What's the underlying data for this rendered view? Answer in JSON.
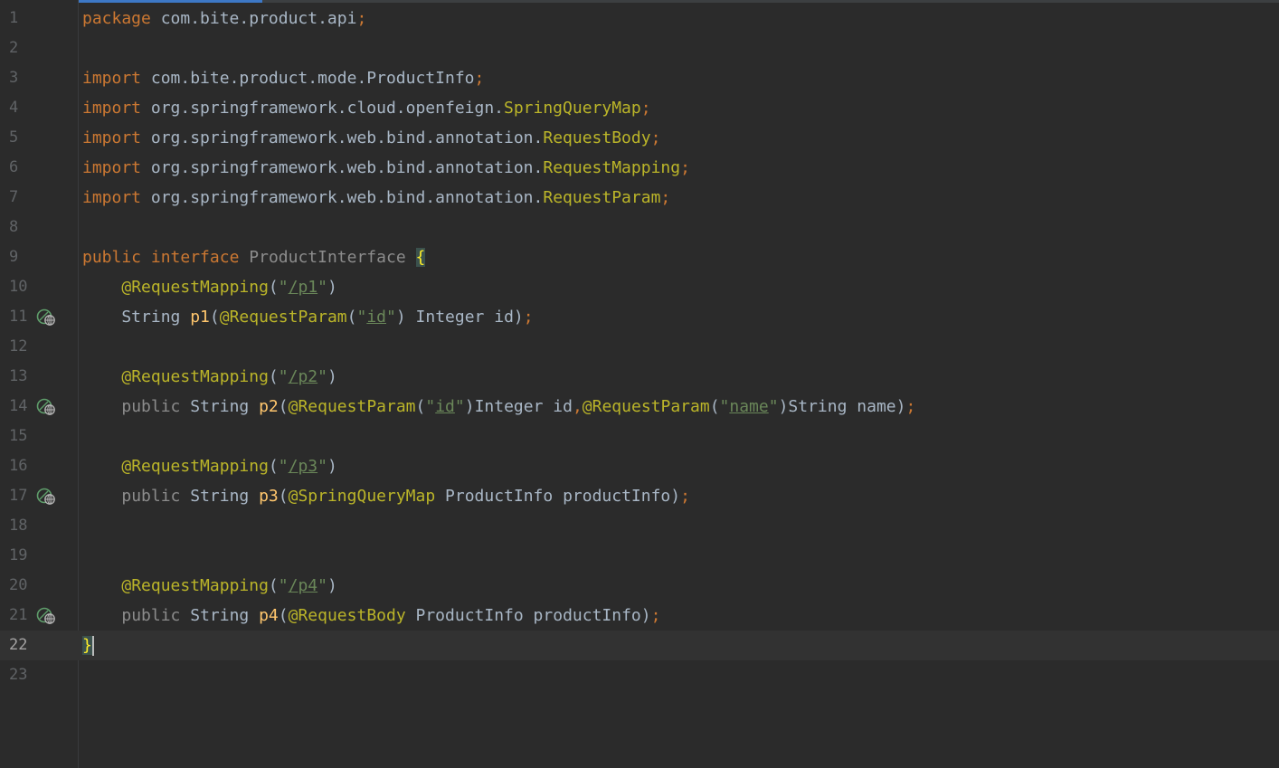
{
  "editor": {
    "progress_fraction": 0.205,
    "current_line": 22,
    "lines": [
      {
        "n": "1",
        "tokens": [
          {
            "t": "package",
            "c": "kw"
          },
          {
            "t": " com.bite.product.api",
            "c": "plain"
          },
          {
            "t": ";",
            "c": "kw"
          }
        ]
      },
      {
        "n": "2",
        "tokens": []
      },
      {
        "n": "3",
        "tokens": [
          {
            "t": "import",
            "c": "kw"
          },
          {
            "t": " com.bite.product.mode.ProductInfo",
            "c": "plain"
          },
          {
            "t": ";",
            "c": "kw"
          }
        ]
      },
      {
        "n": "4",
        "tokens": [
          {
            "t": "import",
            "c": "kw"
          },
          {
            "t": " org.springframework.cloud.openfeign.",
            "c": "plain"
          },
          {
            "t": "SpringQueryMap",
            "c": "ann"
          },
          {
            "t": ";",
            "c": "kw"
          }
        ]
      },
      {
        "n": "5",
        "tokens": [
          {
            "t": "import",
            "c": "kw"
          },
          {
            "t": " org.springframework.web.bind.annotation.",
            "c": "plain"
          },
          {
            "t": "RequestBody",
            "c": "ann"
          },
          {
            "t": ";",
            "c": "kw"
          }
        ]
      },
      {
        "n": "6",
        "tokens": [
          {
            "t": "import",
            "c": "kw"
          },
          {
            "t": " org.springframework.web.bind.annotation.",
            "c": "plain"
          },
          {
            "t": "RequestMapping",
            "c": "ann"
          },
          {
            "t": ";",
            "c": "kw"
          }
        ]
      },
      {
        "n": "7",
        "tokens": [
          {
            "t": "import",
            "c": "kw"
          },
          {
            "t": " org.springframework.web.bind.annotation.",
            "c": "plain"
          },
          {
            "t": "RequestParam",
            "c": "ann"
          },
          {
            "t": ";",
            "c": "kw"
          }
        ]
      },
      {
        "n": "8",
        "tokens": []
      },
      {
        "n": "9",
        "tokens": [
          {
            "t": "public",
            "c": "kw"
          },
          {
            "t": " ",
            "c": "plain"
          },
          {
            "t": "interface",
            "c": "kw"
          },
          {
            "t": " ",
            "c": "plain"
          },
          {
            "t": "ProductInterface",
            "c": "cls-unused"
          },
          {
            "t": " ",
            "c": "plain"
          },
          {
            "t": "{",
            "c": "brace-hl"
          }
        ]
      },
      {
        "n": "10",
        "tokens": [
          {
            "t": "    ",
            "c": "plain"
          },
          {
            "t": "@RequestMapping",
            "c": "ann"
          },
          {
            "t": "(",
            "c": "plain"
          },
          {
            "t": "\"",
            "c": "str"
          },
          {
            "t": "/p1",
            "c": "strlink"
          },
          {
            "t": "\"",
            "c": "str"
          },
          {
            "t": ")",
            "c": "plain"
          }
        ]
      },
      {
        "n": "11",
        "icon": true,
        "tokens": [
          {
            "t": "    String ",
            "c": "plain"
          },
          {
            "t": "p1",
            "c": "fn"
          },
          {
            "t": "(",
            "c": "plain"
          },
          {
            "t": "@RequestParam",
            "c": "ann"
          },
          {
            "t": "(",
            "c": "plain"
          },
          {
            "t": "\"",
            "c": "str"
          },
          {
            "t": "id",
            "c": "strlink"
          },
          {
            "t": "\"",
            "c": "str"
          },
          {
            "t": ") Integer id)",
            "c": "plain"
          },
          {
            "t": ";",
            "c": "kw"
          }
        ]
      },
      {
        "n": "12",
        "tokens": []
      },
      {
        "n": "13",
        "tokens": [
          {
            "t": "    ",
            "c": "plain"
          },
          {
            "t": "@RequestMapping",
            "c": "ann"
          },
          {
            "t": "(",
            "c": "plain"
          },
          {
            "t": "\"",
            "c": "str"
          },
          {
            "t": "/p2",
            "c": "strlink"
          },
          {
            "t": "\"",
            "c": "str"
          },
          {
            "t": ")",
            "c": "plain"
          }
        ]
      },
      {
        "n": "14",
        "icon": true,
        "tokens": [
          {
            "t": "    ",
            "c": "plain"
          },
          {
            "t": "public",
            "c": "muted-kw"
          },
          {
            "t": " String ",
            "c": "plain"
          },
          {
            "t": "p2",
            "c": "fn"
          },
          {
            "t": "(",
            "c": "plain"
          },
          {
            "t": "@RequestParam",
            "c": "ann"
          },
          {
            "t": "(",
            "c": "plain"
          },
          {
            "t": "\"",
            "c": "str"
          },
          {
            "t": "id",
            "c": "strlink"
          },
          {
            "t": "\"",
            "c": "str"
          },
          {
            "t": ")Integer id",
            "c": "plain"
          },
          {
            "t": ",",
            "c": "kw"
          },
          {
            "t": "@RequestParam",
            "c": "ann"
          },
          {
            "t": "(",
            "c": "plain"
          },
          {
            "t": "\"",
            "c": "str"
          },
          {
            "t": "name",
            "c": "strlink"
          },
          {
            "t": "\"",
            "c": "str"
          },
          {
            "t": ")String name)",
            "c": "plain"
          },
          {
            "t": ";",
            "c": "kw"
          }
        ]
      },
      {
        "n": "15",
        "tokens": []
      },
      {
        "n": "16",
        "tokens": [
          {
            "t": "    ",
            "c": "plain"
          },
          {
            "t": "@RequestMapping",
            "c": "ann"
          },
          {
            "t": "(",
            "c": "plain"
          },
          {
            "t": "\"",
            "c": "str"
          },
          {
            "t": "/p3",
            "c": "strlink"
          },
          {
            "t": "\"",
            "c": "str"
          },
          {
            "t": ")",
            "c": "plain"
          }
        ]
      },
      {
        "n": "17",
        "icon": true,
        "tokens": [
          {
            "t": "    ",
            "c": "plain"
          },
          {
            "t": "public",
            "c": "muted-kw"
          },
          {
            "t": " String ",
            "c": "plain"
          },
          {
            "t": "p3",
            "c": "fn"
          },
          {
            "t": "(",
            "c": "plain"
          },
          {
            "t": "@SpringQueryMap",
            "c": "ann"
          },
          {
            "t": " ProductInfo productInfo)",
            "c": "plain"
          },
          {
            "t": ";",
            "c": "kw"
          }
        ]
      },
      {
        "n": "18",
        "tokens": []
      },
      {
        "n": "19",
        "tokens": []
      },
      {
        "n": "20",
        "tokens": [
          {
            "t": "    ",
            "c": "plain"
          },
          {
            "t": "@RequestMapping",
            "c": "ann"
          },
          {
            "t": "(",
            "c": "plain"
          },
          {
            "t": "\"",
            "c": "str"
          },
          {
            "t": "/p4",
            "c": "strlink"
          },
          {
            "t": "\"",
            "c": "str"
          },
          {
            "t": ")",
            "c": "plain"
          }
        ]
      },
      {
        "n": "21",
        "icon": true,
        "tokens": [
          {
            "t": "    ",
            "c": "plain"
          },
          {
            "t": "public",
            "c": "muted-kw"
          },
          {
            "t": " String ",
            "c": "plain"
          },
          {
            "t": "p4",
            "c": "fn"
          },
          {
            "t": "(",
            "c": "plain"
          },
          {
            "t": "@RequestBody",
            "c": "ann"
          },
          {
            "t": " ProductInfo productInfo)",
            "c": "plain"
          },
          {
            "t": ";",
            "c": "kw"
          }
        ]
      },
      {
        "n": "22",
        "caret": true,
        "tokens": [
          {
            "t": "}",
            "c": "brace-hl"
          }
        ]
      },
      {
        "n": "23",
        "tokens": []
      }
    ]
  },
  "icons": {
    "gutter_icon": "web-request-globe-icon"
  },
  "colors": {
    "background": "#2b2b2b",
    "keyword": "#cc7832",
    "annotation": "#bbb529",
    "string": "#6a8759",
    "method": "#ffc66d",
    "text": "#a9b7c6",
    "line_number": "#606366",
    "progress": "#3d78c6"
  }
}
